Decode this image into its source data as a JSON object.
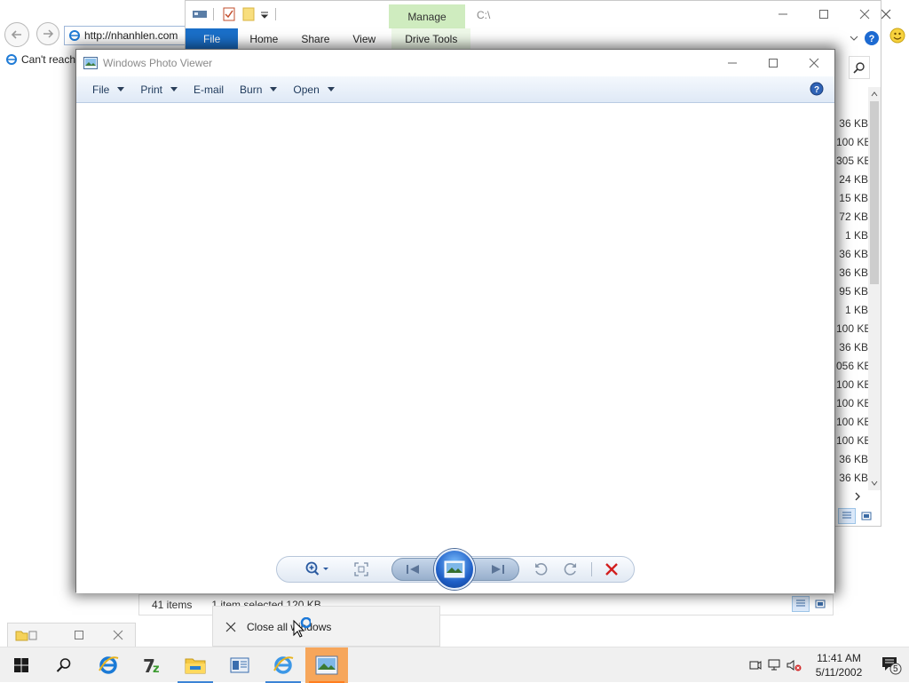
{
  "ie": {
    "address": "http://nhanhlen.com",
    "tab_title": "Can't reach"
  },
  "explorer": {
    "context_tab": "Manage",
    "path": "C:\\",
    "tabs": [
      {
        "label": "File"
      },
      {
        "label": "Home"
      },
      {
        "label": "Share"
      },
      {
        "label": "View"
      },
      {
        "label": "Drive Tools"
      }
    ],
    "sizes": [
      "36 KB",
      "100 KB",
      "305 KB",
      "24 KB",
      "15 KB",
      "72 KB",
      "1 KB",
      "36 KB",
      "36 KB",
      "95 KB",
      "1 KB",
      "100 KB",
      "36 KB",
      "056 KB",
      "100 KB",
      "100 KB",
      "100 KB",
      "100 KB",
      "36 KB",
      "36 KB"
    ],
    "status": {
      "items": "41 items",
      "selected": "1 item selected  120 KB"
    }
  },
  "photo_viewer": {
    "title": "Windows Photo Viewer",
    "menu": [
      {
        "label": "File",
        "caret": true
      },
      {
        "label": "Print",
        "caret": true
      },
      {
        "label": "E-mail",
        "caret": false
      },
      {
        "label": "Burn",
        "caret": true
      },
      {
        "label": "Open",
        "caret": true
      }
    ]
  },
  "jump_list": {
    "close_all": "Close all windows"
  },
  "clock": {
    "time": "11:41 AM",
    "date": "5/11/2002"
  },
  "notifications": {
    "count": "5"
  },
  "colors": {
    "accent": "#1a6fc9",
    "manage_tab": "#cfecbf",
    "taskbar_active": "#f6a65b",
    "delete_red": "#d21f1f"
  }
}
